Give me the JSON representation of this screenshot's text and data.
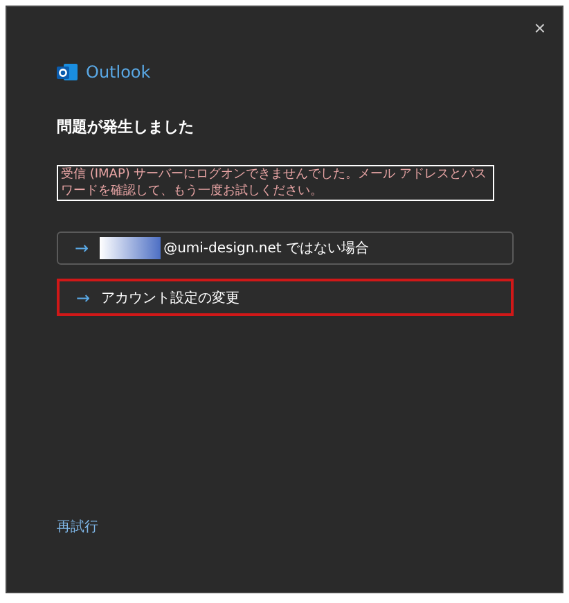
{
  "window": {
    "close": "×"
  },
  "brand": {
    "name": "Outlook"
  },
  "heading": "問題が発生しました",
  "error_message": "受信 (IMAP) サーバーにログオンできませんでした。メール アドレスとパスワードを確認して、もう一度お試しください。",
  "options": [
    {
      "kind": "account",
      "arrow": "→",
      "label": "@umi-design.net ではない場合",
      "highlighted": false
    },
    {
      "kind": "plain",
      "arrow": "→",
      "label": "アカウント設定の変更",
      "highlighted": true
    }
  ],
  "retry_link": "再試行"
}
